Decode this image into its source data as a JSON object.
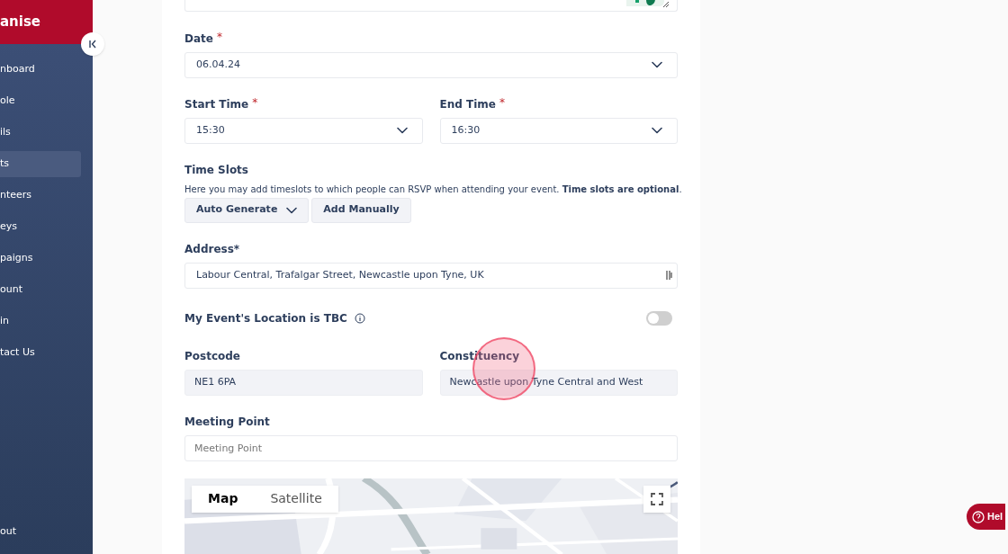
{
  "sidebar": {
    "brand": "anise",
    "items": [
      {
        "label": "nboard",
        "selected": false
      },
      {
        "label": "ole",
        "selected": false
      },
      {
        "label": "ils",
        "selected": false
      },
      {
        "label": "ts",
        "selected": true
      },
      {
        "label": "nteers",
        "selected": false
      },
      {
        "label": "eys",
        "selected": false
      },
      {
        "label": "paigns",
        "selected": false
      },
      {
        "label": "ount",
        "selected": false
      },
      {
        "label": "in",
        "selected": false
      },
      {
        "label": "tact Us",
        "selected": false
      }
    ],
    "footer_item": "out"
  },
  "form": {
    "date": {
      "label": "Date",
      "required_mark": "*",
      "value": "06.04.24"
    },
    "start_time": {
      "label": "Start Time",
      "required_mark": "*",
      "value": "15:30"
    },
    "end_time": {
      "label": "End Time",
      "required_mark": "*",
      "value": "16:30"
    },
    "time_slots": {
      "title": "Time Slots",
      "description": "Here you may add timeslots to which people can RSVP when attending your event. **Time slots are optional**.",
      "buttons": [
        {
          "label": "Auto Generate",
          "kind": "dropdown"
        },
        {
          "label": "Add Manually",
          "kind": "plain"
        }
      ]
    },
    "address": {
      "label": "Address*",
      "value": "Labour Central, Trafalgar Street, Newcastle upon Tyne, UK"
    },
    "location_tbc": {
      "label": "My Event's Location is TBC",
      "on": false
    },
    "postcode": {
      "label": "Postcode",
      "value": "NE1 6PA"
    },
    "constituency": {
      "label": "Constituency",
      "value": "Newcastle upon Tyne Central and West"
    },
    "meeting_point": {
      "label": "Meeting Point",
      "placeholder": "Meeting Point"
    },
    "map": {
      "tabs": [
        {
          "label": "Map",
          "selected": true
        },
        {
          "label": "Satellite",
          "selected": false
        }
      ]
    }
  },
  "help_button": "Hel"
}
